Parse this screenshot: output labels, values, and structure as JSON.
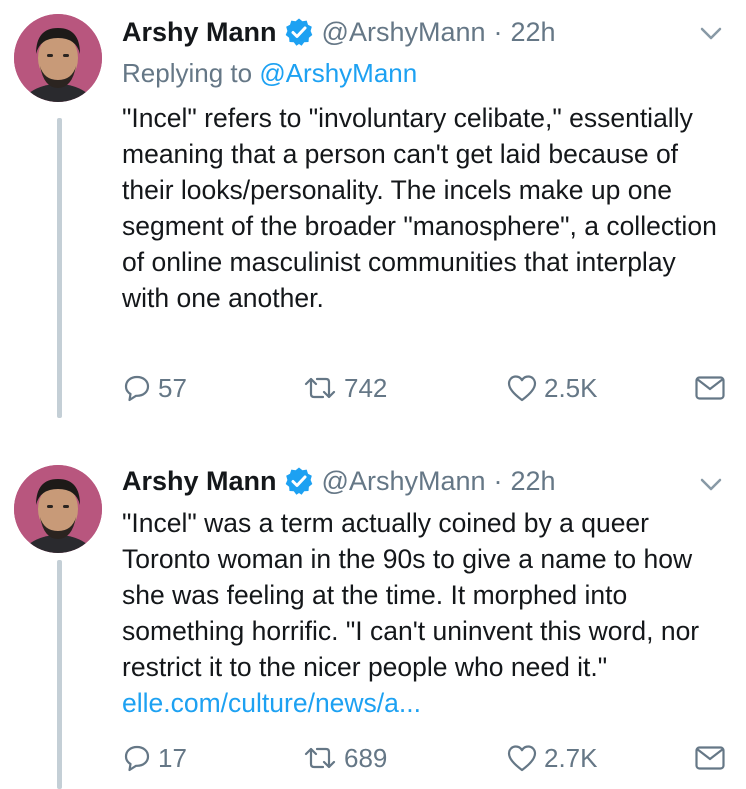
{
  "tweets": [
    {
      "author": {
        "name": "Arshy Mann",
        "handle": "@ArshyMann",
        "verified": true
      },
      "separator": "·",
      "time": "22h",
      "replying": {
        "prefix": "Replying to",
        "handle": "@ArshyMann"
      },
      "body": "\"Incel\" refers to \"involuntary celibate,\" essentially meaning that a person can't get laid because of their looks/personality. The incels make up one segment of the broader \"manosphere\", a collection of online masculinist communities that interplay with one another.",
      "link": "",
      "stats": {
        "replies": "57",
        "retweets": "742",
        "likes": "2.5K"
      }
    },
    {
      "author": {
        "name": "Arshy Mann",
        "handle": "@ArshyMann",
        "verified": true
      },
      "separator": "·",
      "time": "22h",
      "body": "\"Incel\" was a term actually coined by a queer Toronto woman in the 90s to give a name to how she was feeling at the time. It morphed into something horrific. \"I can't uninvent this word, nor restrict it to the nicer people who need it.\"",
      "link": "elle.com/culture/news/a...",
      "stats": {
        "replies": "17",
        "retweets": "689",
        "likes": "2.7K"
      }
    }
  ],
  "icons": {
    "reply": "reply-icon",
    "retweet": "retweet-icon",
    "like": "heart-icon",
    "dm": "envelope-icon",
    "more": "chevron-down-icon",
    "verified": "verified-badge-icon"
  },
  "colors": {
    "text": "#14171a",
    "secondary": "#657786",
    "link": "#1da1f2",
    "verified": "#1da1f2",
    "thread_line": "#c4cfd6",
    "avatar_bg": "#b8567e"
  }
}
